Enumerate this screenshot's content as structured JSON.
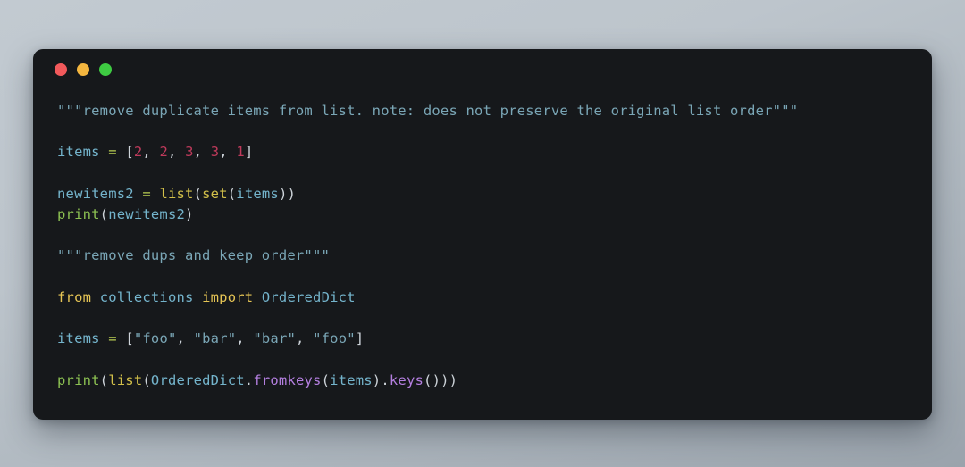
{
  "window": {
    "traffic_lights": [
      {
        "name": "close",
        "label": "Close",
        "color": "#f2595b"
      },
      {
        "name": "minimize",
        "label": "Minimize",
        "color": "#f4b63f"
      },
      {
        "name": "maximize",
        "label": "Maximize",
        "color": "#3ecb42"
      }
    ]
  },
  "theme": {
    "page_background_top": "#c2cad1",
    "page_background_bottom": "#9aa3ac",
    "panel_background": "#16181b",
    "string": "#7aa6b6",
    "number": "#bf3a5b",
    "keyword": "#e6c555",
    "builtin": "#d3c04a",
    "function": "#8cc152",
    "variable": "#74b4cc",
    "method": "#b47fe0",
    "operator": "#b8cc52",
    "punctuation": "#cdd3d9"
  },
  "code": {
    "language": "python",
    "plain_text": "\"\"\"remove duplicate items from list. note: does not preserve the original list order\"\"\"\n\nitems = [2, 2, 3, 3, 1]\n\nnewitems2 = list(set(items))\nprint(newitems2)\n\n\"\"\"remove dups and keep order\"\"\"\n\nfrom collections import OrderedDict\n\nitems = [\"foo\", \"bar\", \"bar\", \"foo\"]\n\nprint(list(OrderedDict.fromkeys(items).keys()))",
    "lines": [
      {
        "id": 1,
        "text": "\"\"\"remove duplicate items from list. note: does not preserve the original list order\"\"\"",
        "tokens": [
          {
            "t": "\"\"\"remove duplicate items from list. note: does not preserve the original list order\"\"\"",
            "c": "tok-doc"
          }
        ]
      },
      {
        "id": 2,
        "text": "",
        "tokens": []
      },
      {
        "id": 3,
        "text": "items = [2, 2, 3, 3, 1]",
        "tokens": [
          {
            "t": "items",
            "c": "tok-var"
          },
          {
            "t": " ",
            "c": "tok-plain"
          },
          {
            "t": "=",
            "c": "tok-op"
          },
          {
            "t": " ",
            "c": "tok-plain"
          },
          {
            "t": "[",
            "c": "tok-punct"
          },
          {
            "t": "2",
            "c": "tok-num"
          },
          {
            "t": ", ",
            "c": "tok-punct"
          },
          {
            "t": "2",
            "c": "tok-num"
          },
          {
            "t": ", ",
            "c": "tok-punct"
          },
          {
            "t": "3",
            "c": "tok-num"
          },
          {
            "t": ", ",
            "c": "tok-punct"
          },
          {
            "t": "3",
            "c": "tok-num"
          },
          {
            "t": ", ",
            "c": "tok-punct"
          },
          {
            "t": "1",
            "c": "tok-num"
          },
          {
            "t": "]",
            "c": "tok-punct"
          }
        ]
      },
      {
        "id": 4,
        "text": "",
        "tokens": []
      },
      {
        "id": 5,
        "text": "newitems2 = list(set(items))",
        "tokens": [
          {
            "t": "newitems2",
            "c": "tok-var"
          },
          {
            "t": " ",
            "c": "tok-plain"
          },
          {
            "t": "=",
            "c": "tok-op"
          },
          {
            "t": " ",
            "c": "tok-plain"
          },
          {
            "t": "list",
            "c": "tok-builtin"
          },
          {
            "t": "(",
            "c": "tok-punct"
          },
          {
            "t": "set",
            "c": "tok-builtin"
          },
          {
            "t": "(",
            "c": "tok-punct"
          },
          {
            "t": "items",
            "c": "tok-var"
          },
          {
            "t": "))",
            "c": "tok-punct"
          }
        ]
      },
      {
        "id": 6,
        "text": "print(newitems2)",
        "tokens": [
          {
            "t": "print",
            "c": "tok-func"
          },
          {
            "t": "(",
            "c": "tok-punct"
          },
          {
            "t": "newitems2",
            "c": "tok-var"
          },
          {
            "t": ")",
            "c": "tok-punct"
          }
        ]
      },
      {
        "id": 7,
        "text": "",
        "tokens": []
      },
      {
        "id": 8,
        "text": "\"\"\"remove dups and keep order\"\"\"",
        "tokens": [
          {
            "t": "\"\"\"remove dups and keep order\"\"\"",
            "c": "tok-doc"
          }
        ]
      },
      {
        "id": 9,
        "text": "",
        "tokens": []
      },
      {
        "id": 10,
        "text": "from collections import OrderedDict",
        "tokens": [
          {
            "t": "from",
            "c": "tok-kw"
          },
          {
            "t": " ",
            "c": "tok-plain"
          },
          {
            "t": "collections",
            "c": "tok-var"
          },
          {
            "t": " ",
            "c": "tok-plain"
          },
          {
            "t": "import",
            "c": "tok-kw"
          },
          {
            "t": " ",
            "c": "tok-plain"
          },
          {
            "t": "OrderedDict",
            "c": "tok-var"
          }
        ]
      },
      {
        "id": 11,
        "text": "",
        "tokens": []
      },
      {
        "id": 12,
        "text": "items = [\"foo\", \"bar\", \"bar\", \"foo\"]",
        "tokens": [
          {
            "t": "items",
            "c": "tok-var"
          },
          {
            "t": " ",
            "c": "tok-plain"
          },
          {
            "t": "=",
            "c": "tok-op"
          },
          {
            "t": " ",
            "c": "tok-plain"
          },
          {
            "t": "[",
            "c": "tok-punct"
          },
          {
            "t": "\"foo\"",
            "c": "tok-string"
          },
          {
            "t": ", ",
            "c": "tok-punct"
          },
          {
            "t": "\"bar\"",
            "c": "tok-string"
          },
          {
            "t": ", ",
            "c": "tok-punct"
          },
          {
            "t": "\"bar\"",
            "c": "tok-string"
          },
          {
            "t": ", ",
            "c": "tok-punct"
          },
          {
            "t": "\"foo\"",
            "c": "tok-string"
          },
          {
            "t": "]",
            "c": "tok-punct"
          }
        ]
      },
      {
        "id": 13,
        "text": "",
        "tokens": []
      },
      {
        "id": 14,
        "text": "print(list(OrderedDict.fromkeys(items).keys()))",
        "tokens": [
          {
            "t": "print",
            "c": "tok-func"
          },
          {
            "t": "(",
            "c": "tok-punct"
          },
          {
            "t": "list",
            "c": "tok-builtin"
          },
          {
            "t": "(",
            "c": "tok-punct"
          },
          {
            "t": "OrderedDict",
            "c": "tok-var"
          },
          {
            "t": ".",
            "c": "tok-punct"
          },
          {
            "t": "fromkeys",
            "c": "tok-method"
          },
          {
            "t": "(",
            "c": "tok-punct"
          },
          {
            "t": "items",
            "c": "tok-var"
          },
          {
            "t": ")",
            "c": "tok-punct"
          },
          {
            "t": ".",
            "c": "tok-punct"
          },
          {
            "t": "keys",
            "c": "tok-method"
          },
          {
            "t": "()))",
            "c": "tok-punct"
          }
        ]
      }
    ]
  }
}
